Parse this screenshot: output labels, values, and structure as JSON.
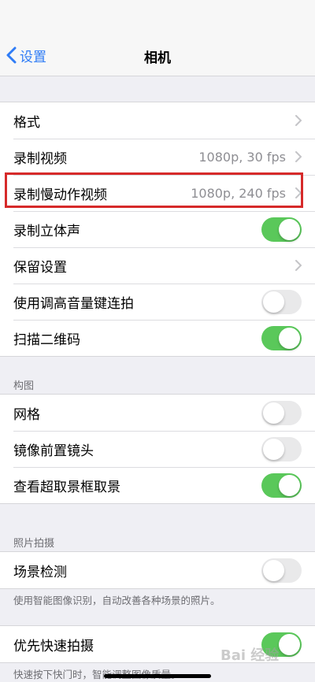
{
  "nav": {
    "back_label": "设置",
    "title": "相机"
  },
  "main_group": {
    "rows": [
      {
        "label": "格式"
      },
      {
        "label": "录制视频",
        "value": "1080p, 30 fps"
      },
      {
        "label": "录制慢动作视频",
        "value": "1080p, 240 fps"
      },
      {
        "label": "录制立体声",
        "toggle": true
      },
      {
        "label": "保留设置"
      },
      {
        "label": "使用调高音量键连拍",
        "toggle": false
      },
      {
        "label": "扫描二维码",
        "toggle": true
      }
    ]
  },
  "composition": {
    "header": "构图",
    "rows": [
      {
        "label": "网格",
        "toggle": false
      },
      {
        "label": "镜像前置镜头",
        "toggle": false
      },
      {
        "label": "查看超取景框取景",
        "toggle": true
      }
    ]
  },
  "photo_capture": {
    "header": "照片拍摄",
    "rows": [
      {
        "label": "场景检测",
        "toggle": false
      }
    ],
    "footnote": "使用智能图像识别，自动改善各种场景的照片。"
  },
  "fast_capture": {
    "rows": [
      {
        "label": "优先快速拍摄",
        "toggle": true
      }
    ],
    "footnote": "快速按下快门时，智能调整图像质量。"
  },
  "watermark": "Bai 经验",
  "colors": {
    "accent": "#2f7cf6",
    "toggle_on": "#5ac85a",
    "highlight": "#d62a2a"
  }
}
